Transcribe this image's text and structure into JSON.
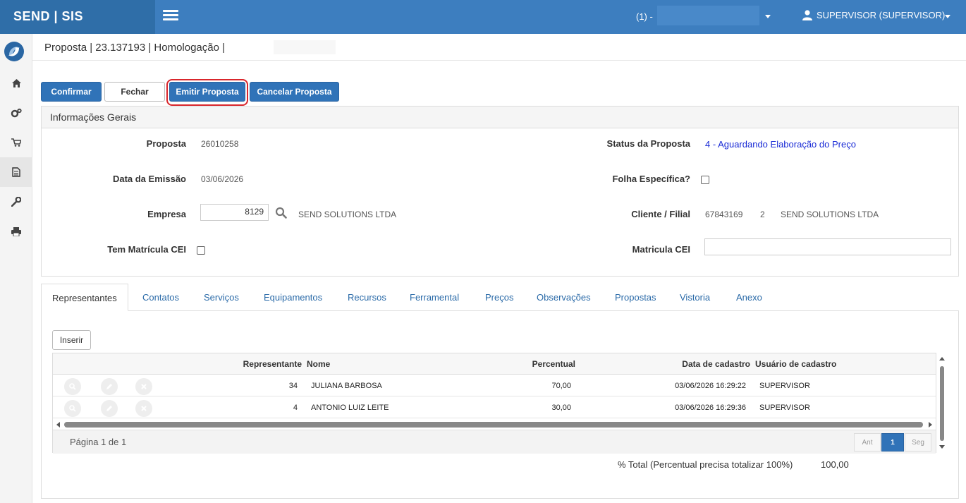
{
  "topbar": {
    "brand": "SEND | SIS",
    "tenant": "(1) -",
    "user": "SUPERVISOR (SUPERVISOR)"
  },
  "header": {
    "breadcrumb": "Proposta | 23.137193 | Homologação |"
  },
  "toolbar": {
    "confirm": "Confirmar",
    "close": "Fechar",
    "emit": "Emitir Proposta",
    "cancel": "Cancelar Proposta"
  },
  "panel": {
    "title": "Informações Gerais",
    "labels": {
      "proposta": "Proposta",
      "data_emissao": "Data da Emissão",
      "empresa": "Empresa",
      "tem_matricula": "Tem Matrícula CEI",
      "status": "Status da Proposta",
      "folha": "Folha Específica?",
      "cliente": "Cliente / Filial",
      "matricula": "Matricula CEI"
    },
    "values": {
      "proposta": "26010258",
      "data_emissao": "03/06/2026",
      "empresa_code": "8129",
      "empresa_name": "SEND SOLUTIONS LTDA",
      "status": "4 - Aguardando Elaboração do Preço",
      "cliente_code": "67843169",
      "filial": "2",
      "cliente_name": "SEND SOLUTIONS LTDA",
      "matricula": ""
    }
  },
  "tabs": [
    "Representantes",
    "Contatos",
    "Serviços",
    "Equipamentos",
    "Recursos",
    "Ferramental",
    "Preços",
    "Observações",
    "Propostas",
    "Vistoria",
    "Anexo"
  ],
  "grid": {
    "insert": "Inserir",
    "columns": [
      "Representante",
      "Nome",
      "Percentual",
      "Data de cadastro",
      "Usuário de cadastro"
    ],
    "rows": [
      {
        "representante": "34",
        "nome": "JULIANA BARBOSA",
        "percentual": "70,00",
        "data": "03/06/2026 16:29:22",
        "usuario": "SUPERVISOR"
      },
      {
        "representante": "4",
        "nome": "ANTONIO LUIZ LEITE",
        "percentual": "30,00",
        "data": "03/06/2026 16:29:36",
        "usuario": "SUPERVISOR"
      }
    ],
    "pager": {
      "text": "Página 1 de 1",
      "prev": "Ant",
      "page": "1",
      "next": "Seg"
    },
    "total_label": "% Total (Percentual precisa totalizar 100%)",
    "total_value": "100,00"
  }
}
